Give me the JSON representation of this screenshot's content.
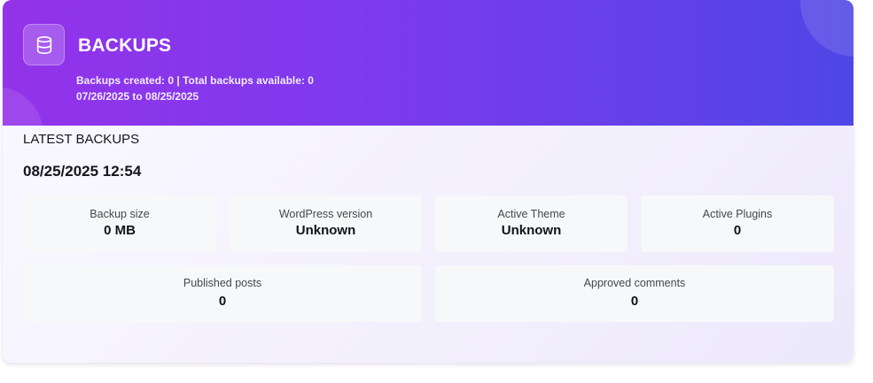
{
  "header": {
    "title": "BACKUPS",
    "summary": "Backups created: 0 | Total backups available: 0",
    "date_range": "07/26/2025 to 08/25/2025",
    "icon": "database-icon"
  },
  "latest": {
    "section_label": "LATEST BACKUPS",
    "datetime": "08/25/2025 12:54"
  },
  "stats": {
    "backup_size": {
      "label": "Backup size",
      "value": "0 MB"
    },
    "wordpress_version": {
      "label": "WordPress version",
      "value": "Unknown"
    },
    "active_theme": {
      "label": "Active Theme",
      "value": "Unknown"
    },
    "active_plugins": {
      "label": "Active Plugins",
      "value": "0"
    },
    "published_posts": {
      "label": "Published posts",
      "value": "0"
    },
    "approved_comments": {
      "label": "Approved comments",
      "value": "0"
    }
  },
  "colors": {
    "header_gradient_start": "#9333ea",
    "header_gradient_end": "#4f46e5",
    "stat_background": "#f7f8fa"
  }
}
